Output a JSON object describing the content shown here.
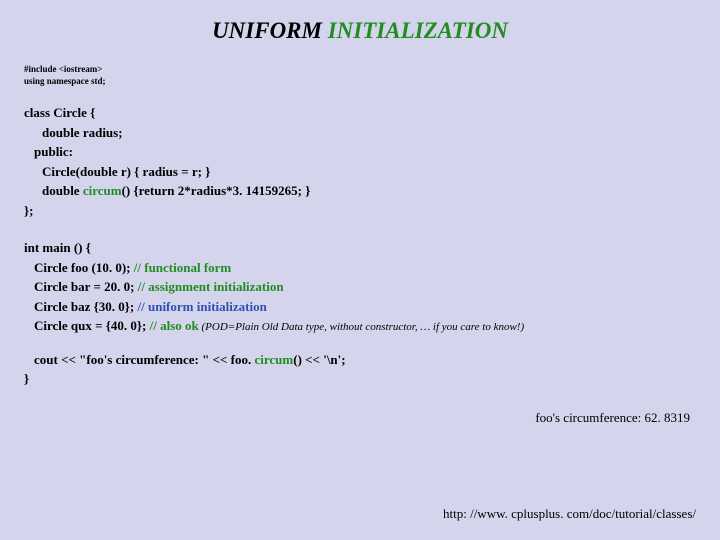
{
  "title": {
    "part1": "UNIFORM ",
    "part2": "INITIALIZATION"
  },
  "includes": {
    "line1": "#include <iostream>",
    "line2": "using namespace std;"
  },
  "classdef": {
    "l1": "class Circle {",
    "l2": "double  radius;",
    "l3": "public:",
    "l4": "Circle(double  r) { radius = r; }",
    "l5a": "double ",
    "l5b": "circum",
    "l5c": "() {return  2*radius*3. 14159265; }",
    "l6": "};"
  },
  "main": {
    "l1": "int main () {",
    "l2a": "Circle  foo (10. 0);   ",
    "l2b": "// functional form",
    "l3a": "Circle  bar = 20. 0;  ",
    "l3b": "// assignment initialization",
    "l4a": "Circle  baz {30. 0};   ",
    "l4b": "// uniform initialization",
    "l5a": "Circle  qux = {40. 0}; ",
    "l5b": "// also ok",
    "l5c": "  (POD=Plain Old Data type, without constructor, … if you care to know!)",
    "l6a": "cout << \"foo's circumference: \" << foo. ",
    "l6b": "circum",
    "l6c": "() << '\\n';",
    "l7": "}"
  },
  "output": "foo's circumference: 62. 8319",
  "url": "http: //www. cplusplus. com/doc/tutorial/classes/"
}
